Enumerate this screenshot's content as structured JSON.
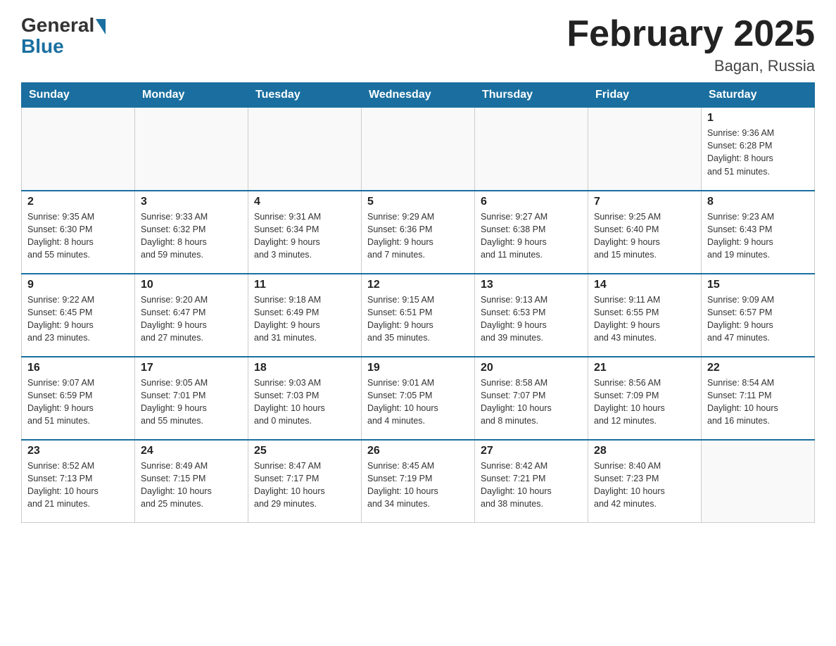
{
  "logo": {
    "general": "General",
    "blue": "Blue"
  },
  "title": "February 2025",
  "location": "Bagan, Russia",
  "days_of_week": [
    "Sunday",
    "Monday",
    "Tuesday",
    "Wednesday",
    "Thursday",
    "Friday",
    "Saturday"
  ],
  "weeks": [
    [
      {
        "day": "",
        "info": ""
      },
      {
        "day": "",
        "info": ""
      },
      {
        "day": "",
        "info": ""
      },
      {
        "day": "",
        "info": ""
      },
      {
        "day": "",
        "info": ""
      },
      {
        "day": "",
        "info": ""
      },
      {
        "day": "1",
        "info": "Sunrise: 9:36 AM\nSunset: 6:28 PM\nDaylight: 8 hours\nand 51 minutes."
      }
    ],
    [
      {
        "day": "2",
        "info": "Sunrise: 9:35 AM\nSunset: 6:30 PM\nDaylight: 8 hours\nand 55 minutes."
      },
      {
        "day": "3",
        "info": "Sunrise: 9:33 AM\nSunset: 6:32 PM\nDaylight: 8 hours\nand 59 minutes."
      },
      {
        "day": "4",
        "info": "Sunrise: 9:31 AM\nSunset: 6:34 PM\nDaylight: 9 hours\nand 3 minutes."
      },
      {
        "day": "5",
        "info": "Sunrise: 9:29 AM\nSunset: 6:36 PM\nDaylight: 9 hours\nand 7 minutes."
      },
      {
        "day": "6",
        "info": "Sunrise: 9:27 AM\nSunset: 6:38 PM\nDaylight: 9 hours\nand 11 minutes."
      },
      {
        "day": "7",
        "info": "Sunrise: 9:25 AM\nSunset: 6:40 PM\nDaylight: 9 hours\nand 15 minutes."
      },
      {
        "day": "8",
        "info": "Sunrise: 9:23 AM\nSunset: 6:43 PM\nDaylight: 9 hours\nand 19 minutes."
      }
    ],
    [
      {
        "day": "9",
        "info": "Sunrise: 9:22 AM\nSunset: 6:45 PM\nDaylight: 9 hours\nand 23 minutes."
      },
      {
        "day": "10",
        "info": "Sunrise: 9:20 AM\nSunset: 6:47 PM\nDaylight: 9 hours\nand 27 minutes."
      },
      {
        "day": "11",
        "info": "Sunrise: 9:18 AM\nSunset: 6:49 PM\nDaylight: 9 hours\nand 31 minutes."
      },
      {
        "day": "12",
        "info": "Sunrise: 9:15 AM\nSunset: 6:51 PM\nDaylight: 9 hours\nand 35 minutes."
      },
      {
        "day": "13",
        "info": "Sunrise: 9:13 AM\nSunset: 6:53 PM\nDaylight: 9 hours\nand 39 minutes."
      },
      {
        "day": "14",
        "info": "Sunrise: 9:11 AM\nSunset: 6:55 PM\nDaylight: 9 hours\nand 43 minutes."
      },
      {
        "day": "15",
        "info": "Sunrise: 9:09 AM\nSunset: 6:57 PM\nDaylight: 9 hours\nand 47 minutes."
      }
    ],
    [
      {
        "day": "16",
        "info": "Sunrise: 9:07 AM\nSunset: 6:59 PM\nDaylight: 9 hours\nand 51 minutes."
      },
      {
        "day": "17",
        "info": "Sunrise: 9:05 AM\nSunset: 7:01 PM\nDaylight: 9 hours\nand 55 minutes."
      },
      {
        "day": "18",
        "info": "Sunrise: 9:03 AM\nSunset: 7:03 PM\nDaylight: 10 hours\nand 0 minutes."
      },
      {
        "day": "19",
        "info": "Sunrise: 9:01 AM\nSunset: 7:05 PM\nDaylight: 10 hours\nand 4 minutes."
      },
      {
        "day": "20",
        "info": "Sunrise: 8:58 AM\nSunset: 7:07 PM\nDaylight: 10 hours\nand 8 minutes."
      },
      {
        "day": "21",
        "info": "Sunrise: 8:56 AM\nSunset: 7:09 PM\nDaylight: 10 hours\nand 12 minutes."
      },
      {
        "day": "22",
        "info": "Sunrise: 8:54 AM\nSunset: 7:11 PM\nDaylight: 10 hours\nand 16 minutes."
      }
    ],
    [
      {
        "day": "23",
        "info": "Sunrise: 8:52 AM\nSunset: 7:13 PM\nDaylight: 10 hours\nand 21 minutes."
      },
      {
        "day": "24",
        "info": "Sunrise: 8:49 AM\nSunset: 7:15 PM\nDaylight: 10 hours\nand 25 minutes."
      },
      {
        "day": "25",
        "info": "Sunrise: 8:47 AM\nSunset: 7:17 PM\nDaylight: 10 hours\nand 29 minutes."
      },
      {
        "day": "26",
        "info": "Sunrise: 8:45 AM\nSunset: 7:19 PM\nDaylight: 10 hours\nand 34 minutes."
      },
      {
        "day": "27",
        "info": "Sunrise: 8:42 AM\nSunset: 7:21 PM\nDaylight: 10 hours\nand 38 minutes."
      },
      {
        "day": "28",
        "info": "Sunrise: 8:40 AM\nSunset: 7:23 PM\nDaylight: 10 hours\nand 42 minutes."
      },
      {
        "day": "",
        "info": ""
      }
    ]
  ]
}
